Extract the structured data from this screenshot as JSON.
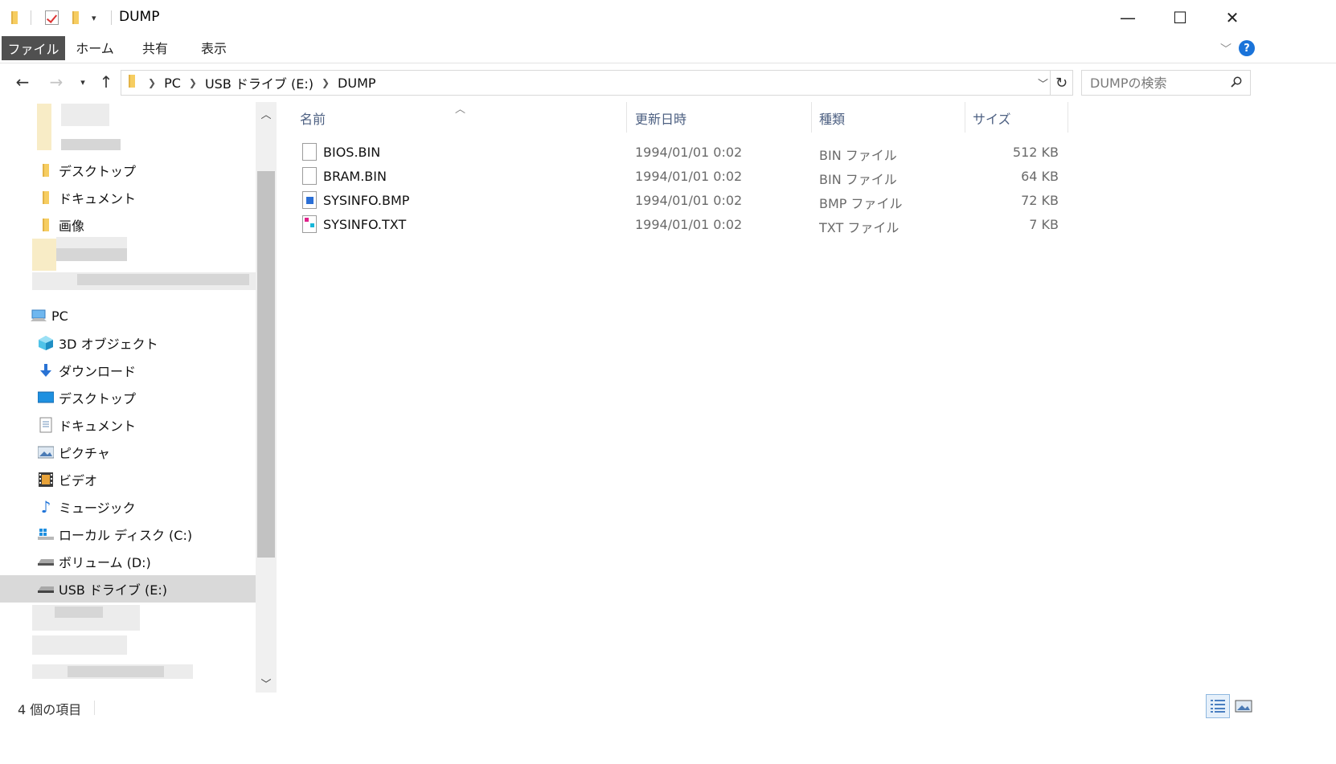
{
  "window": {
    "title": "DUMP",
    "minimize": "—",
    "maximize": "☐",
    "close": "✕"
  },
  "ribbon": {
    "tabs": [
      "ファイル",
      "ホーム",
      "共有",
      "表示"
    ],
    "help": "?"
  },
  "address": {
    "crumbs": [
      "PC",
      "USB ドライブ (E:)",
      "DUMP"
    ],
    "search_placeholder": "DUMPの検索"
  },
  "nav_pane": {
    "quick_access": [
      "デスクトップ",
      "ドキュメント",
      "画像"
    ],
    "pc_label": "PC",
    "pc_items": [
      {
        "label": "3D オブジェクト",
        "icon": "3d-objects-icon"
      },
      {
        "label": "ダウンロード",
        "icon": "download-icon"
      },
      {
        "label": "デスクトップ",
        "icon": "desktop-icon"
      },
      {
        "label": "ドキュメント",
        "icon": "documents-icon"
      },
      {
        "label": "ピクチャ",
        "icon": "pictures-icon"
      },
      {
        "label": "ビデオ",
        "icon": "videos-icon"
      },
      {
        "label": "ミュージック",
        "icon": "music-icon"
      },
      {
        "label": "ローカル ディスク (C:)",
        "icon": "windows-drive-icon"
      },
      {
        "label": "ボリューム (D:)",
        "icon": "drive-icon"
      },
      {
        "label": "USB ドライブ (E:)",
        "icon": "usb-drive-icon"
      }
    ]
  },
  "columns": {
    "name": "名前",
    "date": "更新日時",
    "type": "種類",
    "size": "サイズ"
  },
  "files": [
    {
      "name": "BIOS.BIN",
      "date": "1994/01/01 0:02",
      "type": "BIN ファイル",
      "size": "512 KB",
      "icon": "generic-file-icon"
    },
    {
      "name": "BRAM.BIN",
      "date": "1994/01/01 0:02",
      "type": "BIN ファイル",
      "size": "64 KB",
      "icon": "generic-file-icon"
    },
    {
      "name": "SYSINFO.BMP",
      "date": "1994/01/01 0:02",
      "type": "BMP ファイル",
      "size": "72 KB",
      "icon": "bitmap-file-icon"
    },
    {
      "name": "SYSINFO.TXT",
      "date": "1994/01/01 0:02",
      "type": "TXT ファイル",
      "size": "7 KB",
      "icon": "text-file-icon"
    }
  ],
  "status": {
    "item_count": "4 個の項目"
  },
  "colors": {
    "file_tab_bg": "#505050",
    "selected_nav_bg": "#d9d9d9",
    "header_text": "#4d6082",
    "help_blue": "#1a73d9"
  }
}
